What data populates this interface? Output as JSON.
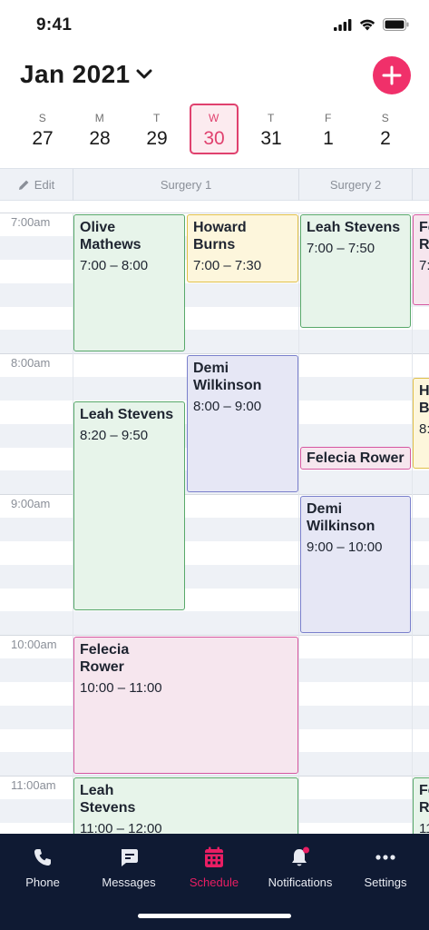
{
  "status": {
    "time": "9:41"
  },
  "header": {
    "month": "Jan 2021",
    "add_icon": "plus-icon",
    "accent": "#f0306a"
  },
  "week": [
    {
      "letter": "S",
      "num": "27",
      "selected": false
    },
    {
      "letter": "M",
      "num": "28",
      "selected": false
    },
    {
      "letter": "T",
      "num": "29",
      "selected": false
    },
    {
      "letter": "W",
      "num": "30",
      "selected": true
    },
    {
      "letter": "T",
      "num": "31",
      "selected": false
    },
    {
      "letter": "F",
      "num": "1",
      "selected": false
    },
    {
      "letter": "S",
      "num": "2",
      "selected": false
    }
  ],
  "columns": {
    "edit": "Edit",
    "col1": "Surgery 1",
    "col2": "Surgery 2"
  },
  "hours": [
    "7:00am",
    "8:00am",
    "9:00am",
    "10:00am",
    "11:00am"
  ],
  "appointments": [
    {
      "name": "Olive Mathews",
      "time": "7:00 – 8:00",
      "color": "green"
    },
    {
      "name": "Howard Burns",
      "time": "7:00 – 7:30",
      "color": "yellow"
    },
    {
      "name": "Leah Stevens",
      "time": "7:00 – 7:50",
      "color": "green"
    },
    {
      "name": "Fe R",
      "time": "7:",
      "color": "pink"
    },
    {
      "name": "Demi Wilkinson",
      "time": "8:00 – 9:00",
      "color": "purple"
    },
    {
      "name": "H B",
      "time": "8:",
      "color": "yellow"
    },
    {
      "name": "Leah Stevens",
      "time": "8:20 – 9:50",
      "color": "green"
    },
    {
      "name": "Felecia Rower",
      "time": "",
      "color": "pink"
    },
    {
      "name": "Demi Wilkinson",
      "time": "9:00 – 10:00",
      "color": "purple"
    },
    {
      "name": "Felecia Rower",
      "time": "10:00 – 11:00",
      "color": "pink"
    },
    {
      "name": "Leah Stevens",
      "time": "11:00 – 12:00",
      "color": "green"
    },
    {
      "name": "Fe R",
      "time": "11",
      "color": "green"
    }
  ],
  "tabs": [
    {
      "label": "Phone",
      "icon": "phone-icon",
      "active": false
    },
    {
      "label": "Messages",
      "icon": "message-icon",
      "active": false
    },
    {
      "label": "Schedule",
      "icon": "calendar-icon",
      "active": true
    },
    {
      "label": "Notifications",
      "icon": "bell-icon",
      "active": false
    },
    {
      "label": "Settings",
      "icon": "more-icon",
      "active": false
    }
  ],
  "tab_active_color": "#e91e63",
  "tabbar_color": "#0f1a33"
}
